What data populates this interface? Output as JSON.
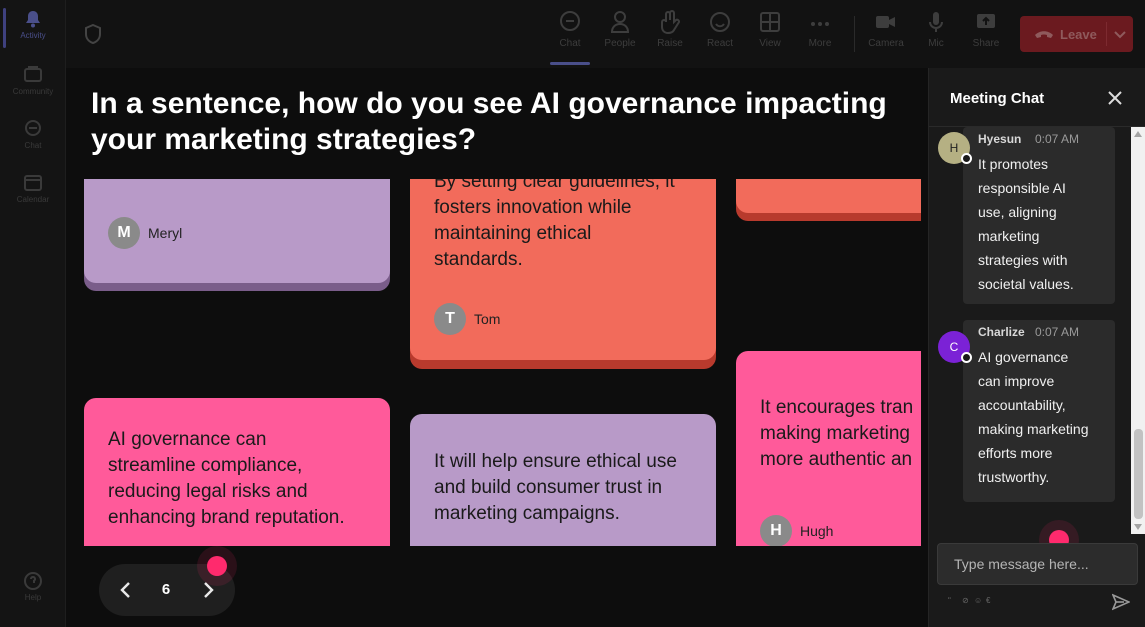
{
  "rail": {
    "items": [
      {
        "label": "Activity",
        "icon": "bell-icon"
      },
      {
        "label": "Community",
        "icon": "community-icon"
      },
      {
        "label": "Chat",
        "icon": "chat-icon"
      },
      {
        "label": "Calendar",
        "icon": "calendar-icon"
      },
      {
        "label": "Help",
        "icon": "help-icon"
      }
    ]
  },
  "toolbar": {
    "chat": "Chat",
    "people": "People",
    "raise": "Raise",
    "react": "React",
    "view": "View",
    "more": "More",
    "camera": "Camera",
    "mic": "Mic",
    "share": "Share",
    "leave": "Leave",
    "leave_color": "#c4314b"
  },
  "stage": {
    "question": "In a sentence, how do you see AI governance impacting your marketing strategies?",
    "cards": [
      {
        "text": "",
        "author": "Meryl",
        "initial": "M",
        "color": "#b89ac8"
      },
      {
        "text": "By setting clear guidelines, it fosters innovation while maintaining ethical standards.",
        "author": "Tom",
        "initial": "T",
        "color": "#f26b5b"
      },
      {
        "text": "",
        "author": "",
        "initial": "",
        "color": "#f26b5b"
      },
      {
        "text": "AI governance can streamline compliance, reducing legal risks and enhancing brand reputation.",
        "author": "",
        "initial": "",
        "color": "#ff5a9a"
      },
      {
        "text": "It will help ensure ethical use and build consumer trust in marketing campaigns.",
        "author": "",
        "initial": "",
        "color": "#b89ac8"
      },
      {
        "text": "It encourages transparency, making marketing efforts more authentic and",
        "author": "Hugh",
        "initial": "H",
        "color": "#ff5a9a"
      }
    ],
    "card_texts": {
      "tom": [
        "By setting clear guidelines, it",
        "fosters innovation while",
        "maintaining ethical",
        "standards."
      ],
      "pink_left": [
        "AI governance can",
        "streamline compliance,",
        "reducing legal risks and",
        "enhancing brand reputation."
      ],
      "purple_mid": [
        "It will help ensure ethical use",
        "and build consumer trust in",
        "marketing campaigns."
      ],
      "pink_right": [
        "It encourages tran",
        "making marketing",
        "more authentic an"
      ]
    },
    "pager": {
      "page": "6"
    }
  },
  "chat": {
    "title": "Meeting Chat",
    "messages": [
      {
        "author": "Hyesun",
        "initial": "H",
        "time": "0:07 AM",
        "avatar_color": "#b5b083",
        "lines": [
          "It promotes",
          "responsible AI",
          "use, aligning",
          "marketing",
          "strategies with",
          "societal values."
        ]
      },
      {
        "author": "Charlize",
        "initial": "C",
        "time": "0:07 AM",
        "avatar_color": "#7b22d6",
        "lines": [
          "AI governance",
          "can improve",
          "accountability,",
          "making marketing",
          "efforts more",
          "trustworthy."
        ]
      }
    ],
    "input_placeholder": "Type message here..."
  }
}
